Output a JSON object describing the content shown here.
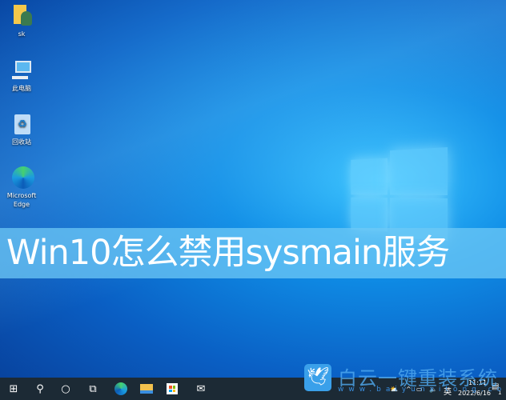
{
  "desktop": {
    "icons": [
      {
        "label": "sk",
        "icon": "user-folder-icon"
      },
      {
        "label": "此电脑",
        "icon": "computer-icon"
      },
      {
        "label": "回收站",
        "icon": "recycle-bin-icon"
      },
      {
        "label": "Microsoft Edge",
        "icon": "edge-icon"
      }
    ]
  },
  "banner": {
    "title": "Win10怎么禁用sysmain服务"
  },
  "taskbar": {
    "items": [
      "start-icon",
      "search-icon",
      "cortana-icon",
      "task-view-icon",
      "edge-icon",
      "file-explorer-icon",
      "store-icon",
      "mail-icon"
    ],
    "tray": {
      "ime": "英",
      "time": "11:11",
      "date": "2022/6/16",
      "notifications": "1"
    }
  },
  "watermark": {
    "name": "白云一键重装系统",
    "url": "www.baiyunxitong.com"
  }
}
